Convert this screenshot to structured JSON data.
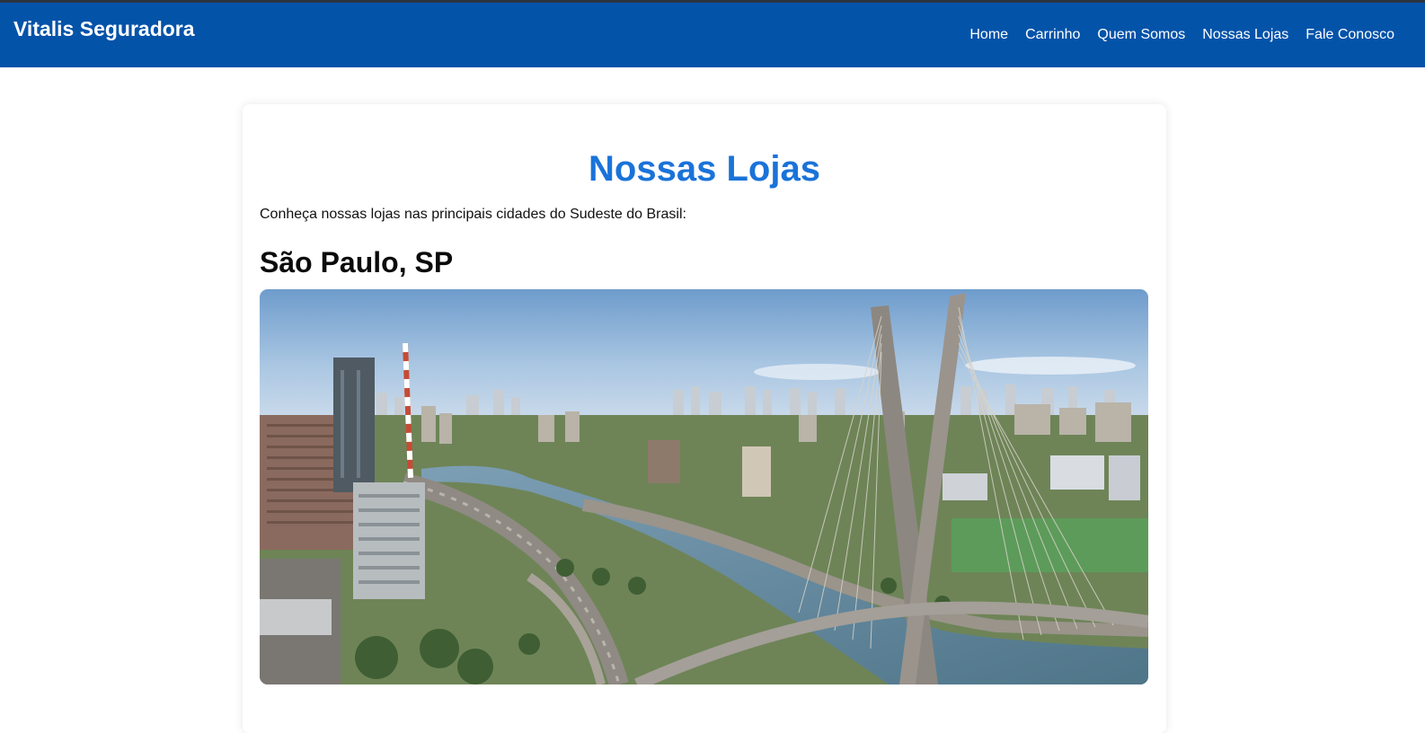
{
  "header": {
    "brand": "Vitalis Seguradora",
    "nav": [
      {
        "label": "Home"
      },
      {
        "label": "Carrinho"
      },
      {
        "label": "Quem Somos"
      },
      {
        "label": "Nossas Lojas"
      },
      {
        "label": "Fale Conosco"
      }
    ]
  },
  "main": {
    "title": "Nossas Lojas",
    "intro": "Conheça nossas lojas nas principais cidades do Sudeste do Brasil:",
    "stores": [
      {
        "city": "São Paulo, SP",
        "photo": "sao-paulo-city-photo"
      }
    ]
  },
  "colors": {
    "navbar": "#0353a9",
    "title": "#1a73d9",
    "text": "#111111"
  }
}
